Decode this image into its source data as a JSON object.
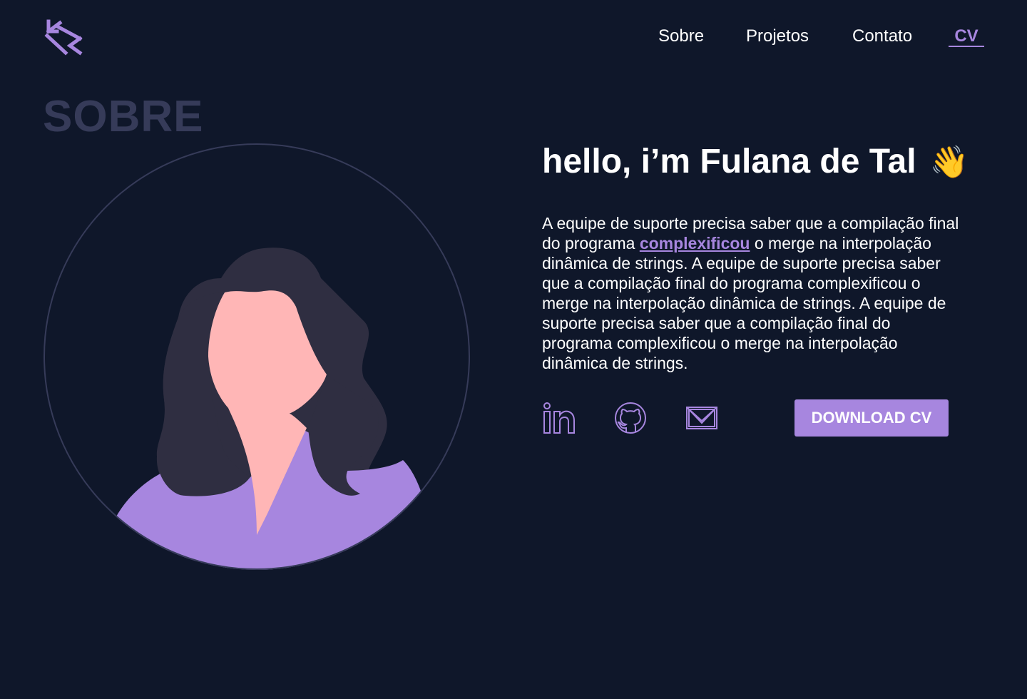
{
  "header": {
    "logo_icon": "brackets-logo-icon",
    "nav": [
      {
        "label": "Sobre"
      },
      {
        "label": "Projetos"
      },
      {
        "label": "Contato"
      },
      {
        "label": "CV"
      }
    ]
  },
  "about": {
    "section_title": "SOBRE",
    "greeting": "hello, i’m Fulana de Tal",
    "wave_emoji": "👋",
    "bio_before_link": "A equipe de suporte precisa saber que a compilação final do programa ",
    "bio_link": "complexificou",
    "bio_after_link": " o merge na interpolação dinâmica de strings. A equipe de suporte precisa saber que a compilação final do programa complexificou o merge na interpolação dinâmica de strings. A equipe de suporte precisa saber que a compilação final do programa complexificou o merge na interpolação dinâmica de strings.",
    "socials": [
      {
        "icon": "linkedin-icon"
      },
      {
        "icon": "github-icon"
      },
      {
        "icon": "mail-icon"
      }
    ],
    "download_label": "DOWNLOAD CV"
  },
  "colors": {
    "background": "#0f172a",
    "accent": "#a786df",
    "section_title": "#363b59",
    "text": "#ffffff"
  }
}
